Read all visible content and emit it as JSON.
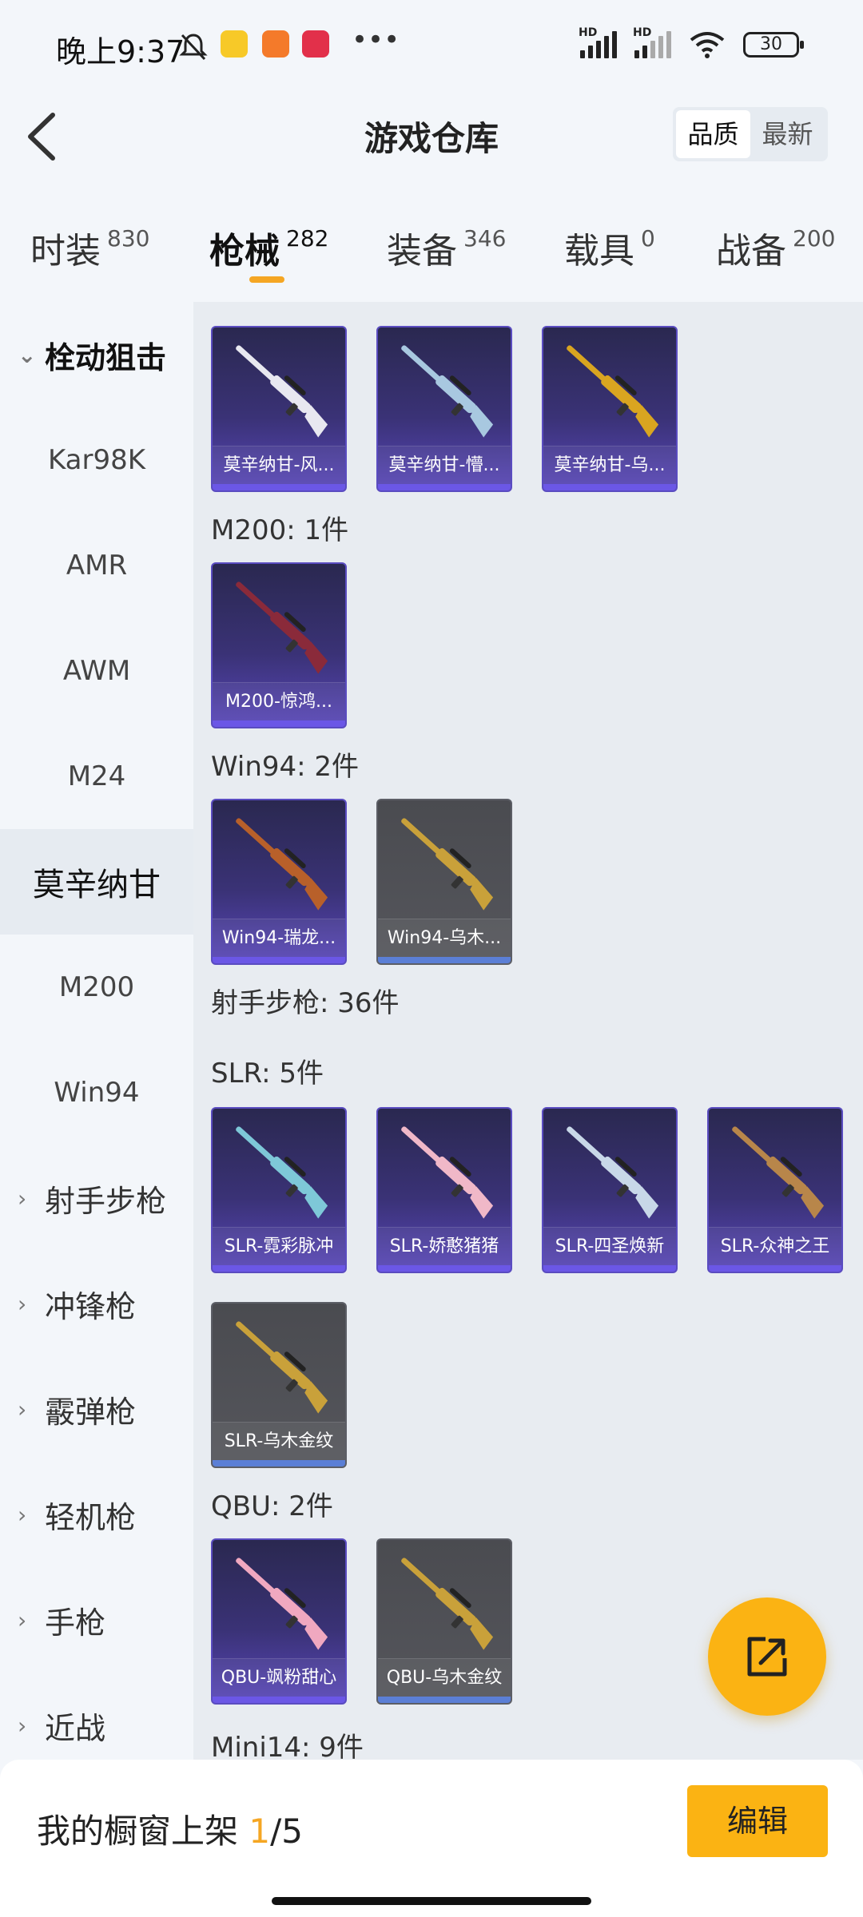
{
  "status_bar": {
    "time": "晚上9:37",
    "signal_label": "HD",
    "battery": "30"
  },
  "header": {
    "title": "游戏仓库",
    "sort_options": [
      "品质",
      "最新"
    ],
    "active_sort": "品质"
  },
  "tabs": [
    {
      "label": "时装",
      "count": "830"
    },
    {
      "label": "枪械",
      "count": "282",
      "active": true
    },
    {
      "label": "装备",
      "count": "346"
    },
    {
      "label": "载具",
      "count": "0"
    },
    {
      "label": "战备",
      "count": "200"
    }
  ],
  "sidebar": {
    "expanded_group": "栓动狙击",
    "sub_items": [
      "Kar98K",
      "AMR",
      "AWM",
      "M24",
      "莫辛纳甘",
      "M200",
      "Win94"
    ],
    "selected_item": "莫辛纳甘",
    "collapsed_groups": [
      "射手步枪",
      "冲锋枪",
      "霰弹枪",
      "轻机枪",
      "手枪",
      "近战"
    ]
  },
  "content": {
    "mosin_items": [
      {
        "name": "莫辛纳甘-风...",
        "quality": "purple",
        "gun_color": "#e8e8f0"
      },
      {
        "name": "莫辛纳甘-懵...",
        "quality": "purple",
        "gun_color": "#a8c8e0"
      },
      {
        "name": "莫辛纳甘-乌...",
        "quality": "purple",
        "gun_color": "#d9a520"
      }
    ],
    "m200_label": "M200: 1件",
    "m200_items": [
      {
        "name": "M200-惊鸿...",
        "quality": "purple",
        "gun_color": "#8a2a3a"
      }
    ],
    "win94_label": "Win94: 2件",
    "win94_items": [
      {
        "name": "Win94-瑞龙...",
        "quality": "purple",
        "gun_color": "#b8602a"
      },
      {
        "name": "Win94-乌木...",
        "quality": "gray",
        "gun_color": "#c9a13a"
      }
    ],
    "marksman_label": "射手步枪: 36件",
    "slr_label": "SLR: 5件",
    "slr_items": [
      {
        "name": "SLR-霓彩脉冲",
        "quality": "purple",
        "gun_color": "#7ec8d8"
      },
      {
        "name": "SLR-娇憨猪猪",
        "quality": "purple",
        "gun_color": "#f0b8c8"
      },
      {
        "name": "SLR-四圣焕新",
        "quality": "purple",
        "gun_color": "#c8d8e8"
      },
      {
        "name": "SLR-众神之王",
        "quality": "purple",
        "gun_color": "#b8864a"
      },
      {
        "name": "SLR-乌木金纹",
        "quality": "gray",
        "gun_color": "#c9a13a"
      }
    ],
    "qbu_label": "QBU: 2件",
    "qbu_items": [
      {
        "name": "QBU-飒粉甜心",
        "quality": "purple",
        "gun_color": "#f0a8c0"
      },
      {
        "name": "QBU-乌木金纹",
        "quality": "gray",
        "gun_color": "#c9a13a"
      }
    ],
    "mini14_label": "Mini14: 9件"
  },
  "bottom_bar": {
    "showcase_prefix": "我的橱窗上架 ",
    "showcase_current": "1",
    "showcase_total": "/5",
    "edit_label": "编辑"
  },
  "icons": {
    "fab": "share-out-icon",
    "back": "back-arrow-icon"
  },
  "colors": {
    "accent": "#fbb313",
    "purple_quality": "#5846b8",
    "gray_quality": "#55565c"
  }
}
